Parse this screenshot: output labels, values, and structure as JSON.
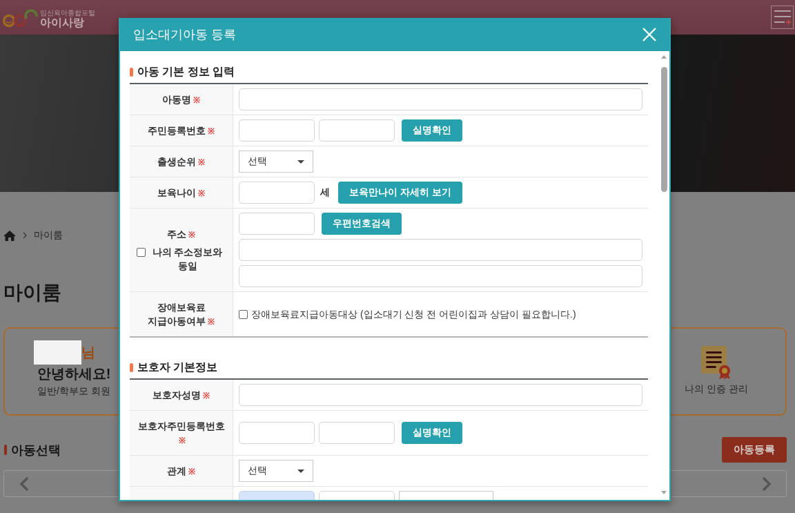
{
  "header": {
    "logo": {
      "tagline": "임신육아종합포털",
      "name": "아이사랑"
    }
  },
  "breadcrumb": [
    "마이룸"
  ],
  "page_title": "마이룸",
  "profile_card": {
    "name_redacted": true,
    "name_suffix": "님",
    "greeting": "안녕하세요!",
    "member_type": "일반/학부모 회원",
    "link": "나의 인증 관리"
  },
  "child_select": {
    "title": "아동선택",
    "register_button": "아동등록"
  },
  "modal": {
    "title": "입소대기아동 등록",
    "sections": [
      {
        "title": "아동 기본 정보 입력",
        "rows": [
          {
            "label": "아동명",
            "mark": "※",
            "lines": [
              [
                {
                  "kind": "input",
                  "autofilled": false
                }
              ]
            ]
          },
          {
            "label": "주민등록번호",
            "mark": "※",
            "lines": [
              [
                {
                  "kind": "input",
                  "autofilled": false
                },
                {
                  "kind": "input",
                  "autofilled": false
                },
                {
                  "kind": "button",
                  "label": "실명확인"
                }
              ]
            ]
          },
          {
            "label": "출생순위",
            "mark": "※",
            "lines": [
              [
                {
                  "kind": "select",
                  "value": "선택"
                }
              ]
            ]
          },
          {
            "label": "보육나이",
            "mark": "※",
            "lines": [
              [
                {
                  "kind": "input",
                  "autofilled": false
                },
                {
                  "kind": "text",
                  "text": "세"
                },
                {
                  "kind": "button",
                  "label": "보육만나이 자세히 보기"
                }
              ]
            ]
          },
          {
            "label": "주소",
            "mark": "※",
            "label_checkbox": {
              "label": "나의 주소정보와 동일",
              "checked": false
            },
            "lines": [
              [
                {
                  "kind": "input",
                  "autofilled": false
                },
                {
                  "kind": "button",
                  "label": "우편번호검색"
                }
              ],
              [
                {
                  "kind": "input",
                  "autofilled": false
                }
              ],
              [
                {
                  "kind": "input",
                  "autofilled": false
                }
              ]
            ]
          },
          {
            "label": "장애보육료 지급아동여부",
            "mark": "※",
            "lines": [
              [
                {
                  "kind": "checkbox",
                  "label": "장애보육료지급아동대상 (입소대기 신청 전 어린이집과 상담이 필요합니다.)",
                  "checked": false
                }
              ]
            ]
          }
        ]
      },
      {
        "title": "보호자 기본정보",
        "rows": [
          {
            "label": "보호자성명",
            "mark": "※",
            "lines": [
              [
                {
                  "kind": "input",
                  "autofilled": false
                }
              ]
            ]
          },
          {
            "label": "보호자주민등록번호",
            "mark": "※",
            "lines": [
              [
                {
                  "kind": "input",
                  "autofilled": false
                },
                {
                  "kind": "input",
                  "autofilled": false
                },
                {
                  "kind": "button",
                  "label": "실명확인"
                }
              ]
            ]
          },
          {
            "label": "관계",
            "mark": "※",
            "lines": [
              [
                {
                  "kind": "select",
                  "value": "선택"
                }
              ]
            ]
          },
          {
            "lines": [
              [
                {
                  "kind": "input",
                  "autofilled": true
                },
                {
                  "kind": "input",
                  "autofilled": false
                },
                {
                  "kind": "select"
                }
              ]
            ]
          }
        ]
      }
    ]
  }
}
